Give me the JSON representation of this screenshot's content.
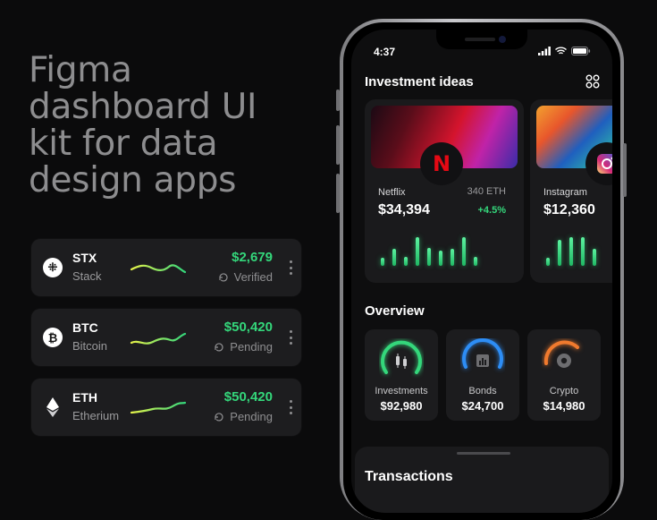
{
  "headline": [
    "Figma",
    "dashboard UI",
    "kit for data",
    "design  apps"
  ],
  "coins": [
    {
      "symbol": "STX",
      "name": "Stack",
      "value": "$2,679",
      "status": "Verified",
      "logo_glyph": "⁜",
      "icon": "stacks-logo-icon"
    },
    {
      "symbol": "BTC",
      "name": "Bitcoin",
      "value": "$50,420",
      "status": "Pending",
      "logo_glyph": "₿",
      "icon": "bitcoin-logo-icon"
    },
    {
      "symbol": "ETH",
      "name": "Etherium",
      "value": "$50,420",
      "status": "Pending",
      "logo_glyph": "◆",
      "icon": "ethereum-logo-icon"
    }
  ],
  "phone": {
    "time": "4:37",
    "investment_title": "Investment ideas",
    "investments": [
      {
        "name": "Netflix",
        "meta": "340 ETH",
        "value": "$34,394",
        "change": "+4.5%",
        "logo": "N",
        "bars": [
          0.25,
          0.55,
          0.3,
          0.95,
          0.6,
          0.5,
          0.55,
          0.95,
          0.3
        ],
        "logo_color": "#e50914"
      },
      {
        "name": "Instagram",
        "meta": "",
        "value": "$12,360",
        "change": "",
        "logo": "",
        "bars": [
          0.25,
          0.85,
          0.95,
          0.95,
          0.55
        ],
        "logo_color": "#e1306c"
      }
    ],
    "overview_title": "Overview",
    "overview": [
      {
        "label": "Investments",
        "value": "$92,980",
        "color": "#34d77b",
        "icon": "candlestick-icon"
      },
      {
        "label": "Bonds",
        "value": "$24,700",
        "color": "#2d8df5",
        "icon": "chart-box-icon"
      },
      {
        "label": "Crypto",
        "value": "$14,980",
        "color": "#f07a2e",
        "icon": "coin-icon"
      }
    ],
    "transactions_title": "Transactions"
  },
  "colors": {
    "accent_green": "#34d77b",
    "muted_text": "#8f8f91",
    "card_bg": "#1d1d1f"
  }
}
